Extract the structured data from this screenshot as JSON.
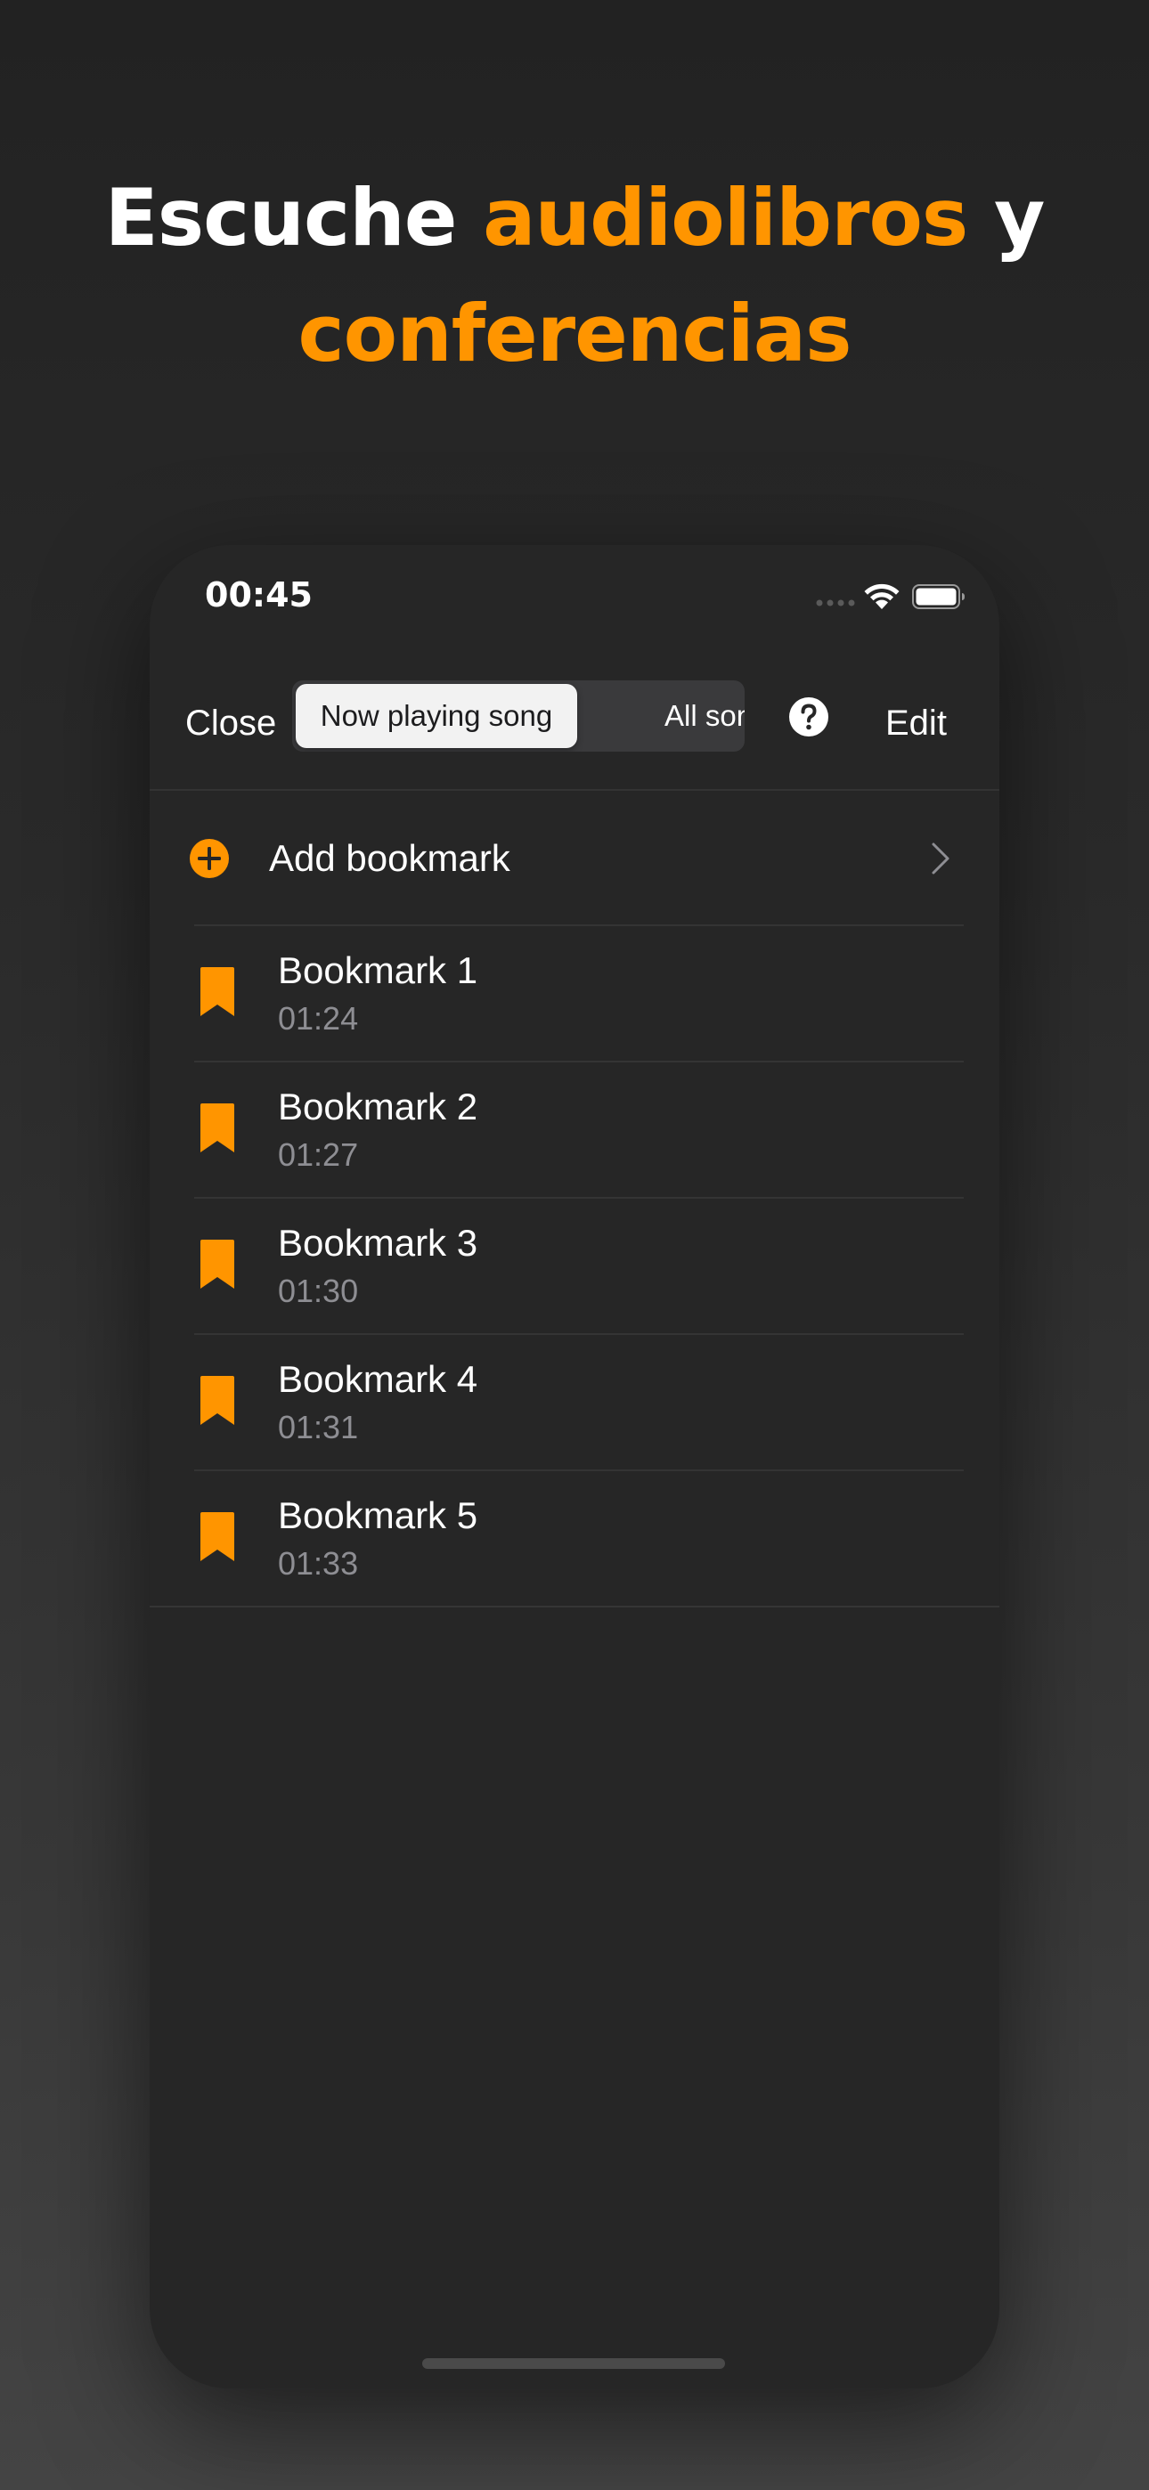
{
  "headline": {
    "part1": "Escuche ",
    "accent1": "audiolibros",
    "part2": " y",
    "accent2": "conferencias"
  },
  "status_bar": {
    "time": "00:45"
  },
  "nav": {
    "close_label": "Close",
    "segments": [
      "Now playing song",
      "All songs"
    ],
    "selected_segment": "Now playing song",
    "edit_label": "Edit"
  },
  "add_bookmark": {
    "label": "Add bookmark"
  },
  "bookmarks": [
    {
      "title": "Bookmark 1",
      "time": "01:24"
    },
    {
      "title": "Bookmark 2",
      "time": "01:27"
    },
    {
      "title": "Bookmark 3",
      "time": "01:30"
    },
    {
      "title": "Bookmark 4",
      "time": "01:31"
    },
    {
      "title": "Bookmark 5",
      "time": "01:33"
    }
  ],
  "colors": {
    "accent": "#ff9500",
    "background": "#262626",
    "secondary_text": "#8e8e93"
  }
}
